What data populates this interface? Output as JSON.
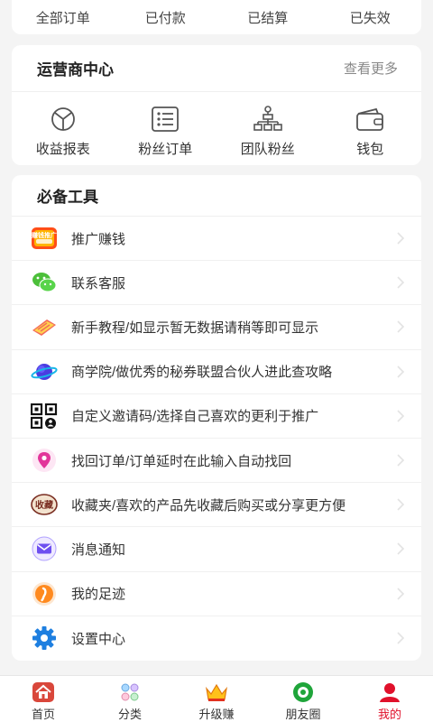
{
  "order_status": [
    "全部订单",
    "已付款",
    "已结算",
    "已失效"
  ],
  "operator_center": {
    "title": "运营商中心",
    "more": "查看更多",
    "items": [
      {
        "label": "收益报表",
        "icon": "pie-chart-icon"
      },
      {
        "label": "粉丝订单",
        "icon": "list-icon"
      },
      {
        "label": "团队粉丝",
        "icon": "org-chart-icon"
      },
      {
        "label": "钱包",
        "icon": "wallet-icon"
      }
    ]
  },
  "tools": {
    "title": "必备工具",
    "items": [
      {
        "label": "推广赚钱",
        "icon": "promote-icon",
        "badge_text": "赚钱推广"
      },
      {
        "label": "联系客服",
        "icon": "wechat-icon"
      },
      {
        "label": "新手教程/如显示暂无数据请稍等即可显示",
        "icon": "tutorial-icon"
      },
      {
        "label": "商学院/做优秀的秘券联盟合伙人进此查攻略",
        "icon": "planet-icon"
      },
      {
        "label": "自定义邀请码/选择自己喜欢的更利于推广",
        "icon": "qr-code-icon"
      },
      {
        "label": "找回订单/订单延时在此输入自动找回",
        "icon": "location-pin-icon"
      },
      {
        "label": "收藏夹/喜欢的产品先收藏后购买或分享更方便",
        "icon": "favorites-icon",
        "badge_text": "收藏"
      },
      {
        "label": "消息通知",
        "icon": "mail-icon"
      },
      {
        "label": "我的足迹",
        "icon": "footprint-icon"
      },
      {
        "label": "设置中心",
        "icon": "gear-icon"
      }
    ]
  },
  "tabbar": [
    {
      "label": "首页",
      "icon": "home-icon"
    },
    {
      "label": "分类",
      "icon": "category-icon"
    },
    {
      "label": "升级赚",
      "icon": "crown-icon"
    },
    {
      "label": "朋友圈",
      "icon": "circle-icon"
    },
    {
      "label": "我的",
      "icon": "user-icon",
      "active": true
    }
  ],
  "colors": {
    "accent": "#e0112b",
    "background": "#f4f4f4",
    "card": "#ffffff"
  }
}
